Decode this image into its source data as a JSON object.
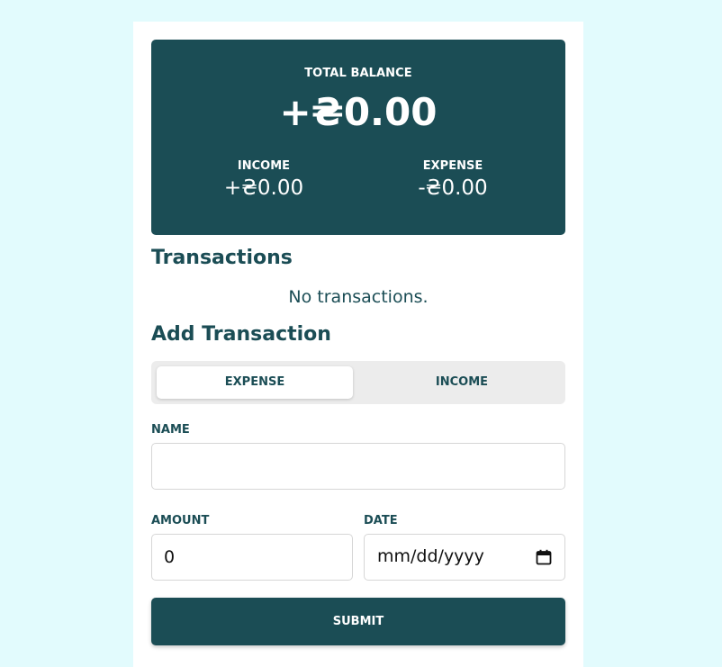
{
  "balance": {
    "total_label": "TOTAL BALANCE",
    "total_value": "+₴0.00",
    "income_label": "INCOME",
    "income_value": "+₴0.00",
    "expense_label": "EXPENSE",
    "expense_value": "-₴0.00"
  },
  "transactions": {
    "heading": "Transactions",
    "empty_message": "No transactions."
  },
  "add_transaction": {
    "heading": "Add Transaction",
    "type_toggle": {
      "options": [
        "EXPENSE",
        "INCOME"
      ],
      "selected": "EXPENSE"
    },
    "name_label": "NAME",
    "name_value": "",
    "amount_label": "AMOUNT",
    "amount_value": "0",
    "date_label": "DATE",
    "date_placeholder": "mm/dd/yyyy",
    "submit_label": "SUBMIT"
  },
  "colors": {
    "background": "#e2fbfd",
    "primary": "#1b4d55",
    "card": "#ffffff",
    "toggle_track": "#ececec"
  },
  "icons": {
    "date_picker": "calendar-icon"
  }
}
